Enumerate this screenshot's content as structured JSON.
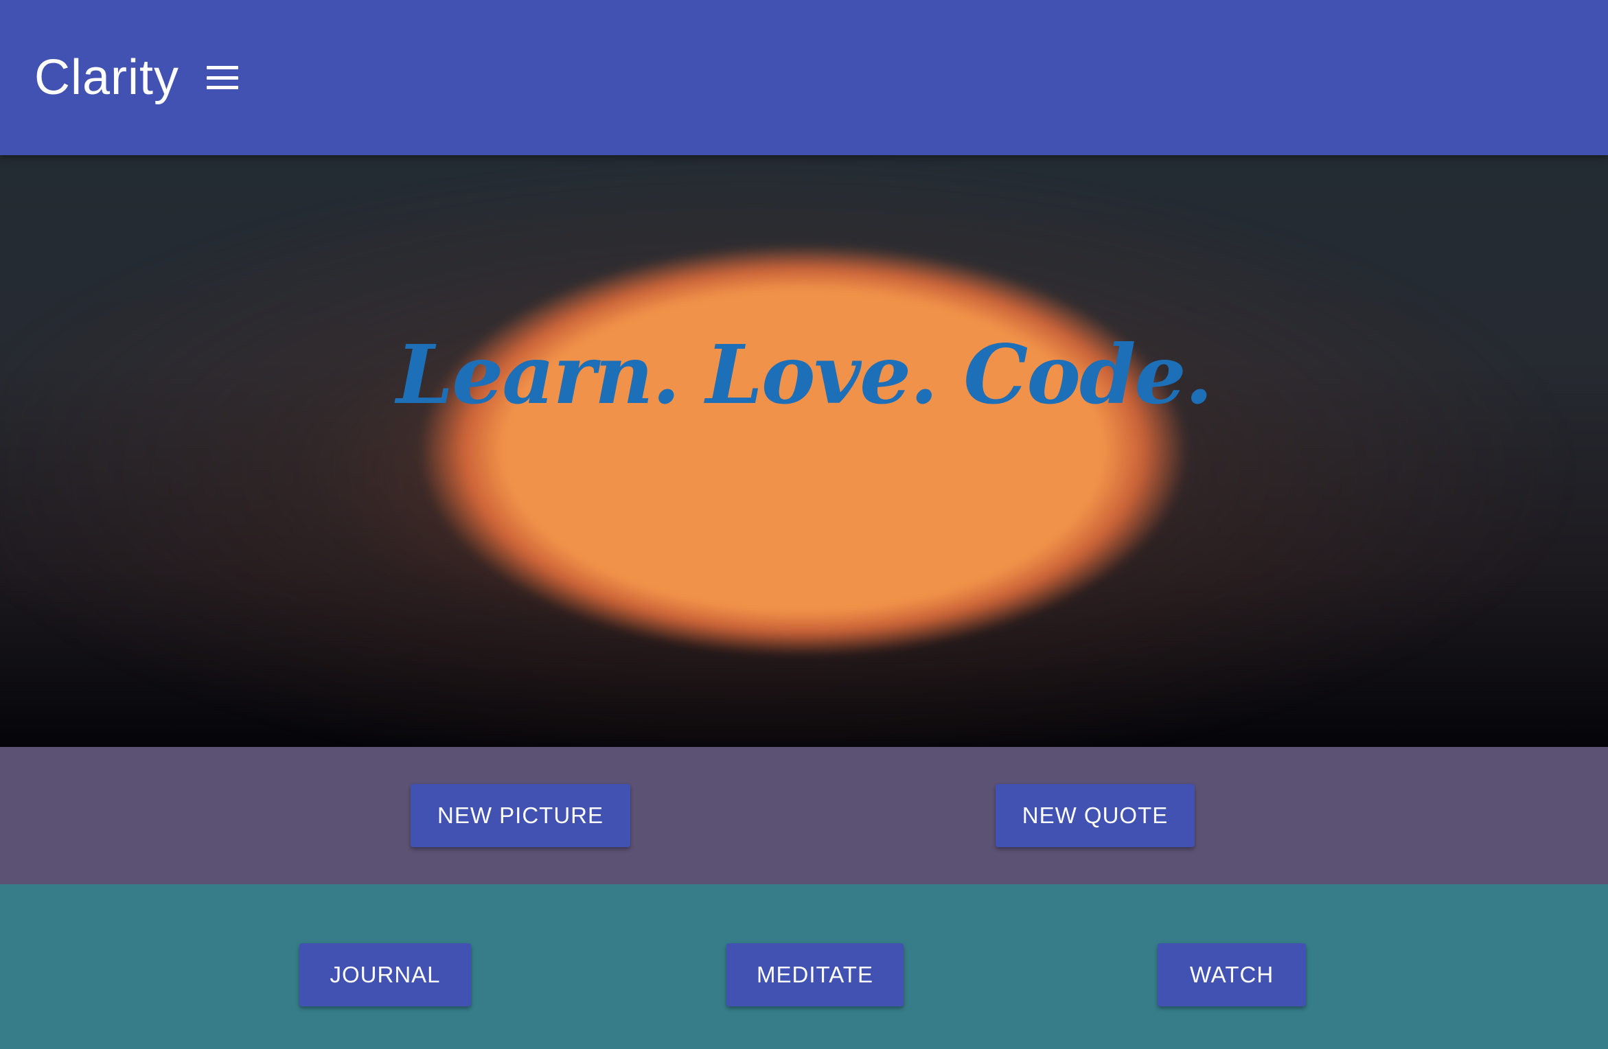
{
  "app": {
    "title": "Clarity"
  },
  "hero": {
    "quote": "Learn. Love. Code."
  },
  "actions": {
    "new_picture": "NEW PICTURE",
    "new_quote": "NEW QUOTE"
  },
  "nav": {
    "journal": "JOURNAL",
    "meditate": "MEDITATE",
    "watch": "WATCH"
  },
  "colors": {
    "app_bar": "#4152b3",
    "button": "#4152b3",
    "action_band": "#5c5274",
    "nav_band": "#367d89",
    "quote_text": "#1d6fb8",
    "sun_glow": "#f1924a"
  },
  "icons": {
    "menu": "menu-icon"
  }
}
